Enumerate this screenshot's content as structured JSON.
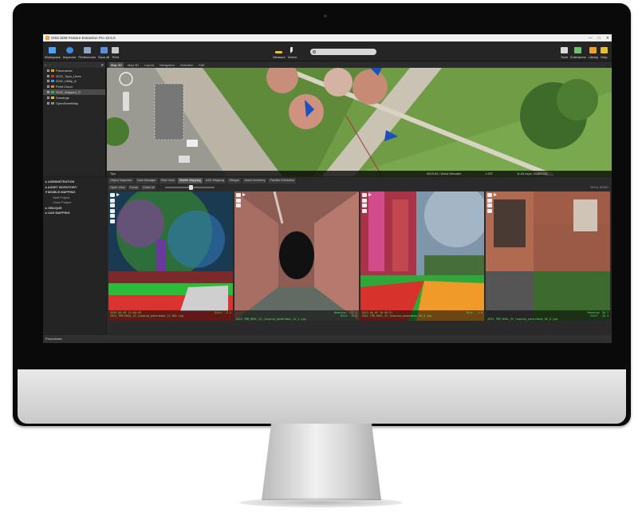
{
  "app": {
    "title": "Orbit 3DM Feature Extraction Pro 10.6.0"
  },
  "window_controls": [
    "—",
    "□",
    "✕"
  ],
  "toolbar": {
    "left": [
      {
        "label": "Workspace",
        "icon": "workspace-icon",
        "color": "#4aa3ff"
      },
      {
        "label": "Inspector",
        "icon": "inspector-icon",
        "color": "#3b8de0"
      },
      {
        "label": "Preferences",
        "icon": "preferences-icon",
        "color": "#8aa5c8"
      },
      {
        "label": "Save all",
        "icon": "save-icon",
        "color": "#5b8fd6"
      },
      {
        "label": "Print",
        "icon": "print-icon",
        "color": "#c8c8c8"
      }
    ],
    "center": [
      {
        "label": "Measure",
        "icon": "measure-icon",
        "color": "#f0c020"
      },
      {
        "label": "Select",
        "icon": "cursor-icon",
        "color": "#e6e6e6"
      }
    ],
    "right": [
      {
        "label": "Tools",
        "icon": "tools-icon",
        "color": "#d9d9d9"
      },
      {
        "label": "Extensions",
        "icon": "extensions-icon",
        "color": "#6cc36c"
      },
      {
        "label": "Library",
        "icon": "library-icon",
        "color": "#f0a030"
      },
      {
        "label": "Help",
        "icon": "help-icon",
        "color": "#e8c02a"
      }
    ]
  },
  "layers": {
    "items": [
      {
        "label": "Panoramas",
        "color": "#e0a020"
      },
      {
        "label": "2022_Topo_Lines",
        "color": "#c0392b"
      },
      {
        "label": "2022_Utility_A",
        "color": "#3498db"
      },
      {
        "label": "Point Cloud",
        "color": "#e67e22"
      },
      {
        "label": "2022_Mapped_O",
        "color": "#27ae60",
        "selected": true
      },
      {
        "label": "Drawings",
        "color": "#d4c040"
      },
      {
        "label": "OpenStreetMap",
        "color": "#7f8c8d"
      }
    ]
  },
  "map": {
    "tabs": [
      "Map 2D",
      "Map 3D",
      "Layout",
      "Navigation",
      "Selection",
      "Edit"
    ],
    "status": [
      "Tips",
      "WGS 84 / World Mercator",
      "1:297",
      "11.83 m/px, 1048/4136"
    ]
  },
  "nav": {
    "items": [
      {
        "label": "ADMINISTRATION",
        "sub": []
      },
      {
        "label": "ASSET INVENTORY",
        "sub": []
      },
      {
        "label": "MOBILE MAPPING",
        "sub": [
          "Start Project",
          "Close Project"
        ]
      },
      {
        "label": "OBLIQUE",
        "sub": []
      },
      {
        "label": "UAS MAPPING",
        "sub": []
      }
    ]
  },
  "views": {
    "tabs": [
      "Object Inspector",
      "Task Manager",
      "Slice View",
      "Mobile Mapping",
      "UAS Mapping",
      "Oblique",
      "Asset Inventory",
      "Parallel Extraction"
    ],
    "controls": [
      "Open View",
      "Focus",
      "Close all"
    ],
    "tag": "RHUL DEMO",
    "panoramas": [
      {
        "time": "2019-06-05 11:00:20",
        "dist": "Dist: -3.2",
        "path": "2022_TRM_RHUL_V2_Looping_panoramas_12_002.jpg"
      },
      {
        "time": "Heading: -71.1",
        "dist": "Dist: -8.0",
        "path": "2022_TRM_RHUL_V2_looping_panoramas_14_2.jpg"
      },
      {
        "time": "2019-06-05 10:58:57",
        "dist": "Dist: -1.8",
        "path": "2022_TRM_RHUL_V2_looping_panoramas_08_0.jpg"
      },
      {
        "time": "Heading: 50.7",
        "dist": "Dist: -16.4",
        "path": "2022_TRM_RHUL_V2_looping_panoramas_06_0.jpg"
      }
    ]
  },
  "footer": {
    "label": "Procedures"
  }
}
